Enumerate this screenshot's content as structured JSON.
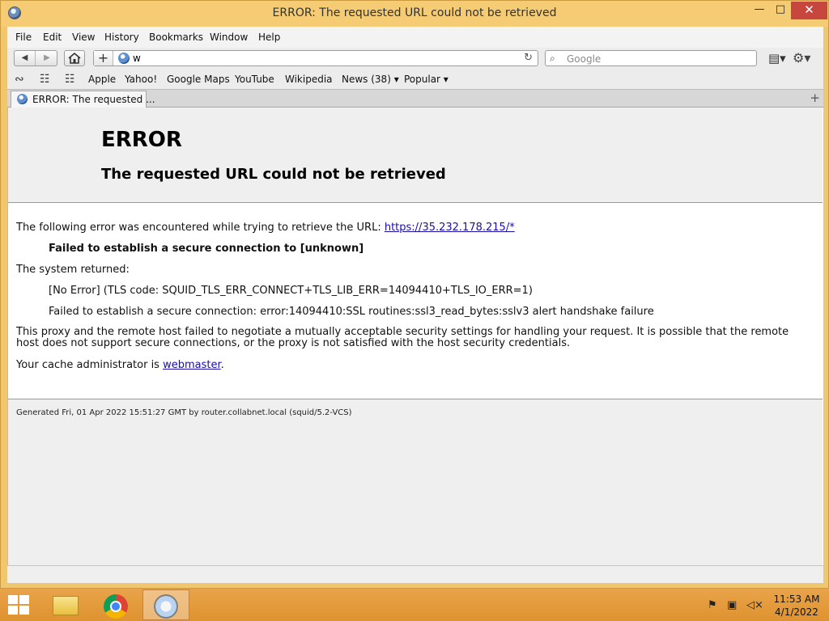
{
  "window": {
    "title": "ERROR: The requested URL could not be retrieved",
    "min_glyph": "—",
    "max_glyph": "□",
    "close_glyph": "✕"
  },
  "menu": {
    "items": [
      "File",
      "Edit",
      "View",
      "History",
      "Bookmarks",
      "Window",
      "Help"
    ]
  },
  "toolbar": {
    "back_glyph": "◀",
    "forward_glyph": "▶",
    "home_glyph": "⌂",
    "add_glyph": "+",
    "address_value": "w",
    "reload_glyph": "↻",
    "search_placeholder": "Google",
    "search_glyph": "⌕",
    "page_glyph": "▤▾",
    "gear_glyph": "⚙▾"
  },
  "bookmarks": {
    "reading_glyph": "∾",
    "book_glyph": "☷",
    "grid_glyph": "☷",
    "items": [
      "Apple",
      "Yahoo!",
      "Google Maps",
      "YouTube",
      "Wikipedia",
      "News (38) ▾",
      "Popular ▾"
    ]
  },
  "tab": {
    "label": "ERROR: The requested ...",
    "add_glyph": "+"
  },
  "page": {
    "heading": "ERROR",
    "subheading": "The requested URL could not be retrieved",
    "intro": "The following error was encountered while trying to retrieve the URL: ",
    "url_link": "https://35.232.178.215/*",
    "failed": "Failed to establish a secure connection to [unknown]",
    "system_returned": "The system returned:",
    "no_error": "[No Error] (TLS code: SQUID_TLS_ERR_CONNECT+TLS_LIB_ERR=14094410+TLS_IO_ERR=1)",
    "ssl_error": "Failed to establish a secure connection: error:14094410:SSL routines:ssl3_read_bytes:sslv3 alert handshake failure",
    "proxy_note": "This proxy and the remote host failed to negotiate a mutually acceptable security settings for handling your request. It is possible that the remote host does not support secure connections, or the proxy is not satisfied with the host security credentials.",
    "admin_prefix": "Your cache administrator is ",
    "admin_link": "webmaster",
    "admin_suffix": ".",
    "footer": "Generated Fri, 01 Apr 2022 15:51:27 GMT by router.collabnet.local (squid/5.2-VCS)"
  },
  "taskbar": {
    "clock_time": "11:53 AM",
    "clock_date": "4/1/2022",
    "tray_flag": "⚑",
    "tray_network": "▣",
    "tray_volume": "◁×"
  },
  "colors": {
    "title_bar": "#f5cc73",
    "taskbar": "#e29a3a",
    "link": "#1a0dab",
    "close_button": "#c7473f"
  }
}
